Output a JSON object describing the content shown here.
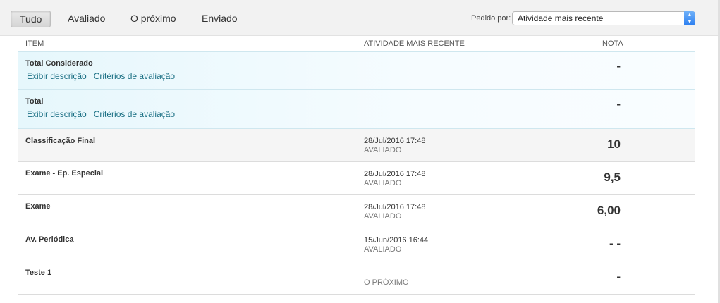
{
  "tabs": [
    {
      "label": "Tudo",
      "active": true
    },
    {
      "label": "Avaliado",
      "active": false
    },
    {
      "label": "O próximo",
      "active": false
    },
    {
      "label": "Enviado",
      "active": false
    }
  ],
  "sort": {
    "label": "Pedido por:",
    "value": "Atividade mais recente"
  },
  "columns": {
    "item": "ITEM",
    "activity": "ATIVIDADE MAIS RECENTE",
    "grade": "NOTA"
  },
  "links": {
    "description": "Exibir descrição",
    "criteria": "Critérios de avaliação"
  },
  "rows": [
    {
      "name": "Total Considerado",
      "date": "",
      "status": "",
      "grade": "-"
    },
    {
      "name": "Total",
      "date": "",
      "status": "",
      "grade": "-"
    },
    {
      "name": "Classificação Final",
      "date": "28/Jul/2016 17:48",
      "status": "AVALIADO",
      "grade": "10"
    },
    {
      "name": "Exame - Ep. Especial",
      "date": "28/Jul/2016 17:48",
      "status": "AVALIADO",
      "grade": "9,5"
    },
    {
      "name": "Exame",
      "date": "28/Jul/2016 17:48",
      "status": "AVALIADO",
      "grade": "6,00"
    },
    {
      "name": "Av. Periódica",
      "date": "15/Jun/2016 16:44",
      "status": "AVALIADO",
      "grade": "- -"
    },
    {
      "name": "Teste 1",
      "date": "",
      "status": "O PRÓXIMO",
      "grade": "-"
    }
  ]
}
